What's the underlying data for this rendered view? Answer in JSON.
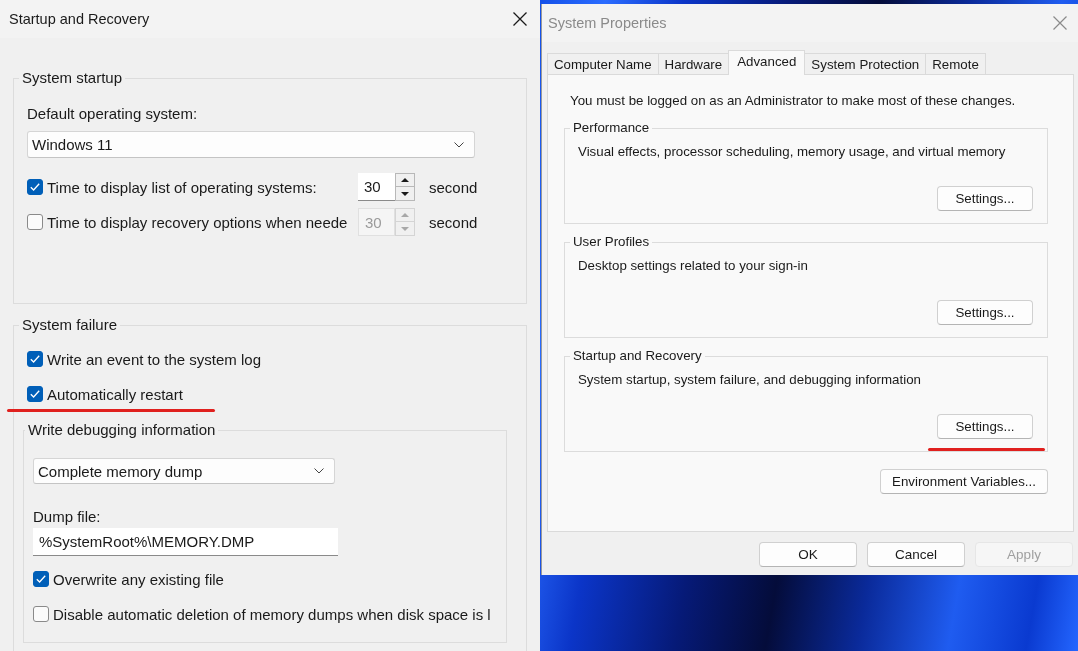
{
  "recovery_dialog": {
    "title": "Startup and Recovery",
    "system_startup": {
      "legend": "System startup",
      "os_label": "Default operating system:",
      "os_value": "Windows 11",
      "timers": [
        {
          "label": "Time to display list of operating systems:",
          "checked": true,
          "value": "30",
          "disabled": false,
          "unit": "second"
        },
        {
          "label": "Time to display recovery options when neede",
          "checked": false,
          "value": "30",
          "disabled": true,
          "unit": "second"
        }
      ]
    },
    "system_failure": {
      "legend": "System failure",
      "options": [
        {
          "label": "Write an event to the system log",
          "checked": true,
          "highlighted": false
        },
        {
          "label": "Automatically restart",
          "checked": true,
          "highlighted": true
        }
      ],
      "debugging": {
        "legend": "Write debugging information",
        "dump_type": "Complete memory dump",
        "dump_file_label": "Dump file:",
        "dump_file": "%SystemRoot%\\MEMORY.DMP",
        "options": [
          {
            "label": "Overwrite any existing file",
            "checked": true
          },
          {
            "label": "Disable automatic deletion of memory dumps when disk space is l",
            "checked": false
          }
        ]
      }
    }
  },
  "system_properties": {
    "title": "System Properties",
    "tabs": [
      {
        "label": "Computer Name",
        "selected": false
      },
      {
        "label": "Hardware",
        "selected": false
      },
      {
        "label": "Advanced",
        "selected": true
      },
      {
        "label": "System Protection",
        "selected": false
      },
      {
        "label": "Remote",
        "selected": false
      }
    ],
    "notice": "You must be logged on as an Administrator to make most of these changes.",
    "groups": [
      {
        "legend": "Performance",
        "description": "Visual effects, processor scheduling, memory usage, and virtual memory",
        "button": "Settings...",
        "highlighted": false
      },
      {
        "legend": "User Profiles",
        "description": "Desktop settings related to your sign-in",
        "button": "Settings...",
        "highlighted": false
      },
      {
        "legend": "Startup and Recovery",
        "description": "System startup, system failure, and debugging information",
        "button": "Settings...",
        "highlighted": true
      }
    ],
    "environment_button": "Environment Variables...",
    "buttons": [
      {
        "label": "OK",
        "disabled": false
      },
      {
        "label": "Cancel",
        "disabled": false
      },
      {
        "label": "Apply",
        "disabled": true
      }
    ]
  }
}
